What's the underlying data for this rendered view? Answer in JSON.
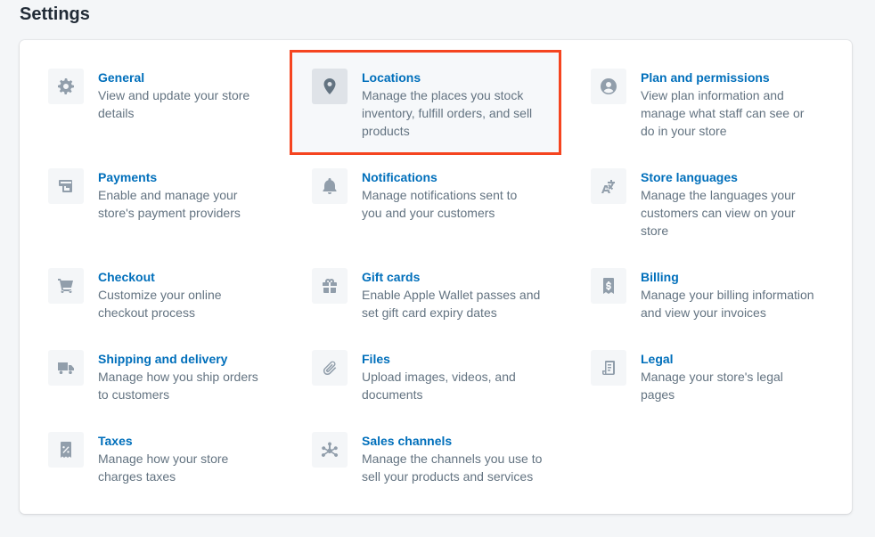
{
  "page_title": "Settings",
  "colors": {
    "link": "#006fbb",
    "muted": "#637381",
    "highlight": "#f5441f"
  },
  "items": [
    {
      "title": "General",
      "desc": [
        "View and update your store",
        "details"
      ],
      "icon": "gear-icon"
    },
    {
      "title": "Locations",
      "desc": [
        "Manage the places you stock",
        "inventory, fulfill orders, and sell",
        "products"
      ],
      "icon": "location-pin-icon"
    },
    {
      "title": "Plan and permissions",
      "desc": [
        "View plan information and",
        "manage what staff can see or",
        "do in your store"
      ],
      "icon": "user-circle-icon"
    },
    {
      "title": "Payments",
      "desc": [
        "Enable and manage your",
        "store's payment providers"
      ],
      "icon": "credit-card-icon"
    },
    {
      "title": "Notifications",
      "desc": [
        "Manage notifications sent to",
        "you and your customers"
      ],
      "icon": "bell-icon"
    },
    {
      "title": "Store languages",
      "desc": [
        "Manage the languages your",
        "customers can view on your",
        "store"
      ],
      "icon": "translate-icon"
    },
    {
      "title": "Checkout",
      "desc": [
        "Customize your online",
        "checkout process"
      ],
      "icon": "cart-icon"
    },
    {
      "title": "Gift cards",
      "desc": [
        "Enable Apple Wallet passes and",
        "set gift card expiry dates"
      ],
      "icon": "gift-icon"
    },
    {
      "title": "Billing",
      "desc": [
        "Manage your billing information",
        "and view your invoices"
      ],
      "icon": "receipt-dollar-icon"
    },
    {
      "title": "Shipping and delivery",
      "desc": [
        "Manage how you ship orders",
        "to customers"
      ],
      "icon": "truck-icon"
    },
    {
      "title": "Files",
      "desc": [
        "Upload images, videos, and",
        "documents"
      ],
      "icon": "paperclip-icon"
    },
    {
      "title": "Legal",
      "desc": [
        "Manage your store's legal",
        "pages"
      ],
      "icon": "document-icon"
    },
    {
      "title": "Taxes",
      "desc": [
        "Manage how your store",
        "charges taxes"
      ],
      "icon": "tax-receipt-icon"
    },
    {
      "title": "Sales channels",
      "desc": [
        "Manage the channels you use to",
        "sell your products and services"
      ],
      "icon": "channels-icon"
    }
  ]
}
